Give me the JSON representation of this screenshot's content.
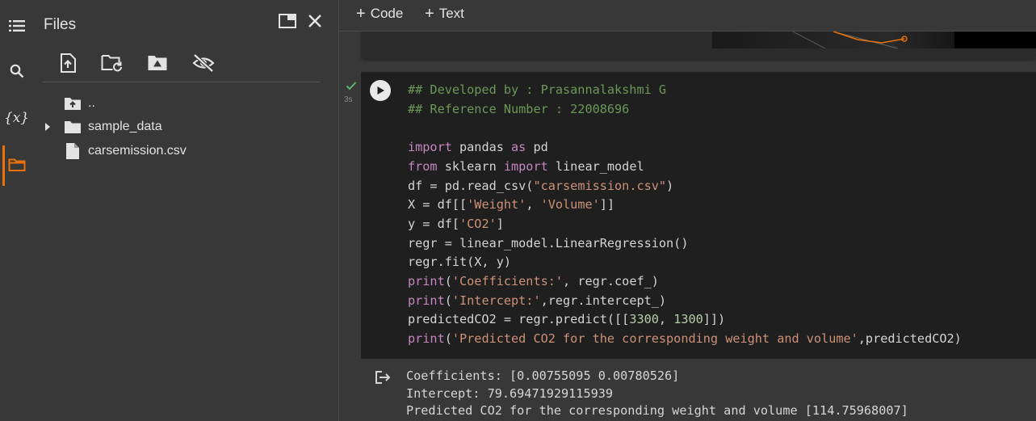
{
  "colors": {
    "background": "#383838",
    "cell_background": "#1f1f1f",
    "accent_orange": "#e8710a",
    "success_green": "#5bb974",
    "comment": "#6a9955",
    "keyword": "#c586c0",
    "string": "#ce9178",
    "number": "#b5cea8"
  },
  "rail": {
    "items": [
      {
        "name": "table-of-contents",
        "icon": "list-icon"
      },
      {
        "name": "find-and-replace",
        "icon": "search-icon"
      },
      {
        "name": "variables",
        "icon": "variable-icon",
        "glyph": "{x}"
      },
      {
        "name": "files",
        "icon": "folder-icon",
        "active": true
      }
    ]
  },
  "files_panel": {
    "title": "Files",
    "toolbar": [
      "upload-file-icon",
      "refresh-folder-icon",
      "mount-drive-icon",
      "hide-files-icon"
    ],
    "tree": [
      {
        "label": "..",
        "icon": "folder-up-icon"
      },
      {
        "label": "sample_data",
        "icon": "folder-icon",
        "expandable": true
      },
      {
        "label": "carsemission.csv",
        "icon": "file-icon"
      }
    ]
  },
  "toolbar": {
    "code_label": "Code",
    "text_label": "Text"
  },
  "cell": {
    "exec_time": "3s",
    "code_lines": [
      "## Developed by : Prasannalakshmi G",
      "## Reference Number : 22008696",
      "",
      "import pandas as pd",
      "from sklearn import linear_model",
      "df = pd.read_csv(\"carsemission.csv\")",
      "X = df[['Weight', 'Volume']]",
      "y = df['CO2']",
      "regr = linear_model.LinearRegression()",
      "regr.fit(X, y)",
      "print('Coefficients:', regr.coef_)",
      "print('Intercept:',regr.intercept_)",
      "predictedCO2 = regr.predict([[3300, 1300]])",
      "print('Predicted CO2 for the corresponding weight and volume',predictedCO2)"
    ],
    "output_lines": [
      "Coefficients: [0.00755095 0.00780526]",
      "Intercept: 79.69471929115939",
      "Predicted CO2 for the corresponding weight and volume [114.75968007]"
    ]
  }
}
